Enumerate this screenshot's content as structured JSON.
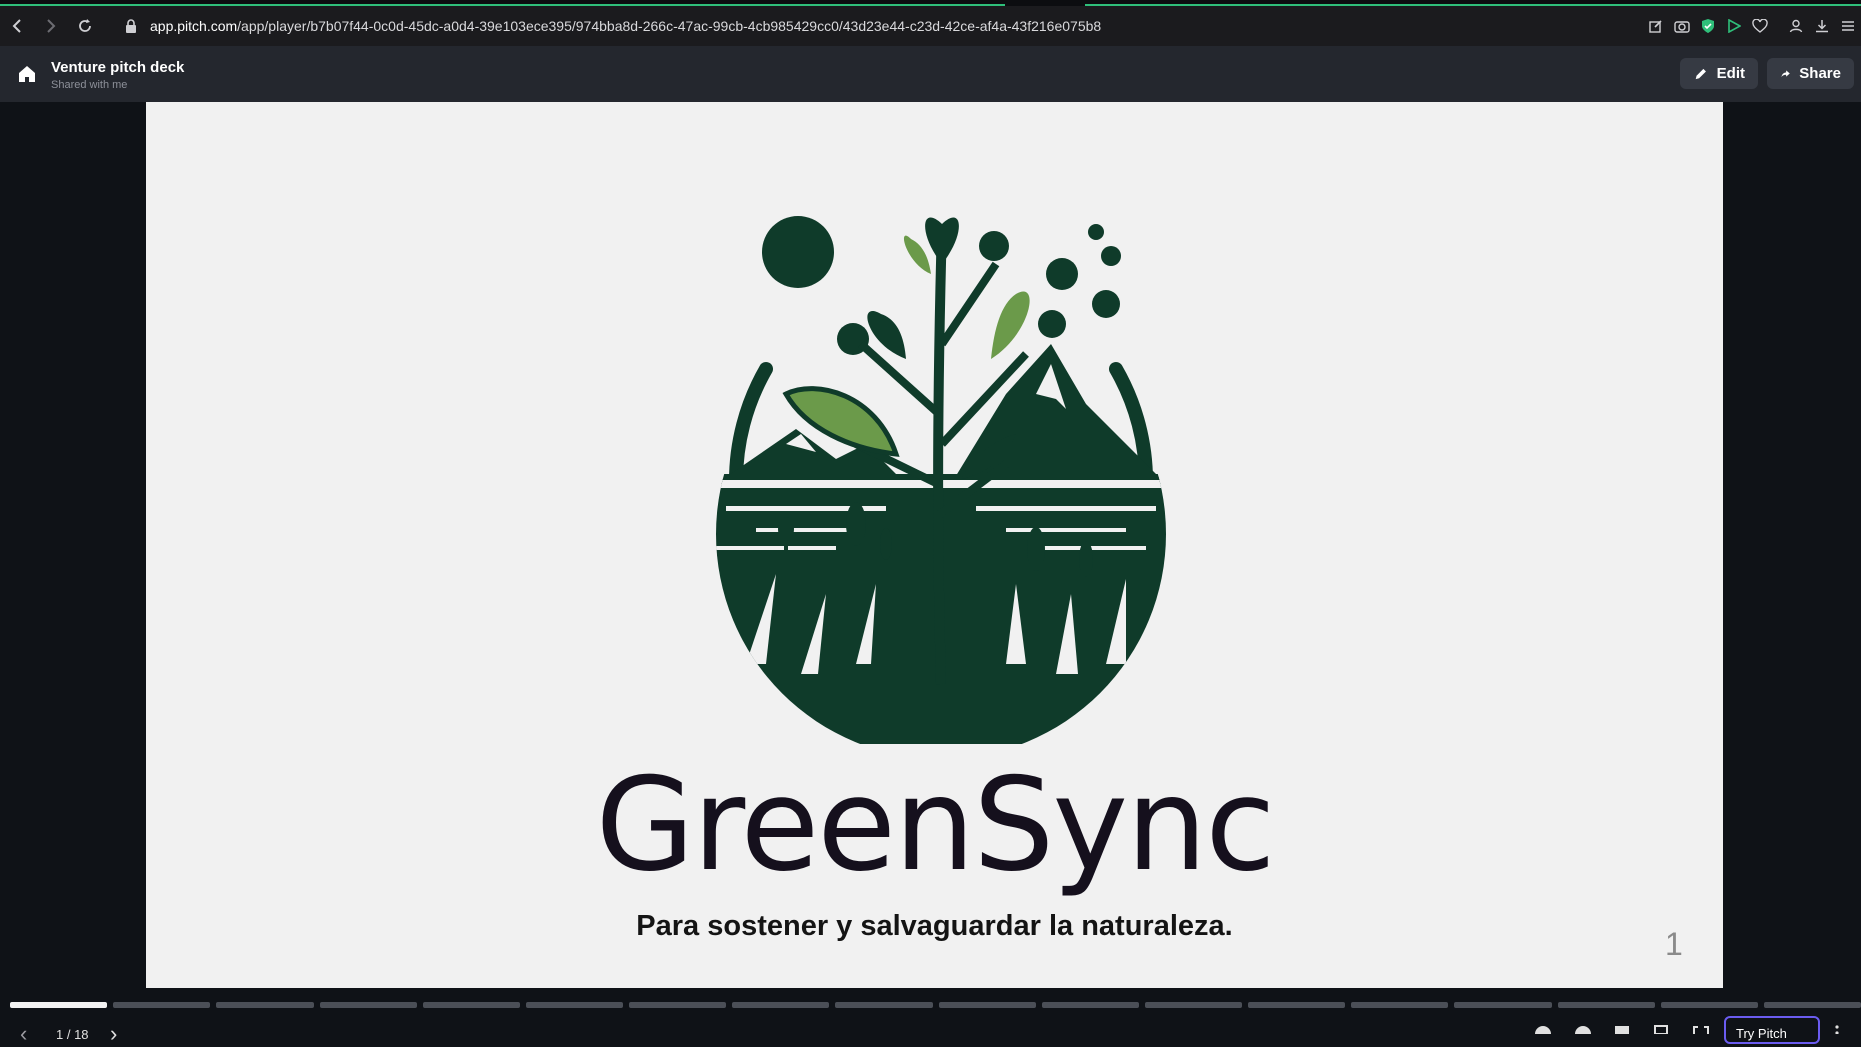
{
  "browser": {
    "url_host": "app.pitch.com",
    "url_path": "/app/player/b7b07f44-0c0d-45dc-a0d4-39e103ece395/974bba8d-266c-47ac-99cb-4cb985429cc0/43d23e44-c23d-42ce-af4a-43f216e075b8",
    "icons": [
      "back-icon",
      "forward-icon",
      "reload-icon",
      "lock-icon",
      "edit-page-icon",
      "camera-icon",
      "shield-icon",
      "play-icon",
      "heart-icon",
      "profile-icon",
      "download-icon",
      "menu-icon"
    ]
  },
  "header": {
    "title": "Venture pitch deck",
    "subtitle": "Shared with me",
    "edit_label": "Edit",
    "share_label": "Share"
  },
  "slide": {
    "brand": "GreenSync",
    "tagline": "Para sostener y salvaguardar la naturaleza.",
    "page_number": "1"
  },
  "player": {
    "page_indicator": "1 / 18",
    "total_slides": 18,
    "current_slide": 1,
    "try_label": "Try  Pitch"
  },
  "colors": {
    "logo_dark": "#0f3b2a",
    "logo_leaf": "#6b9a4a",
    "accent_green": "#2fbf7a",
    "try_border": "#6b5cf0"
  }
}
